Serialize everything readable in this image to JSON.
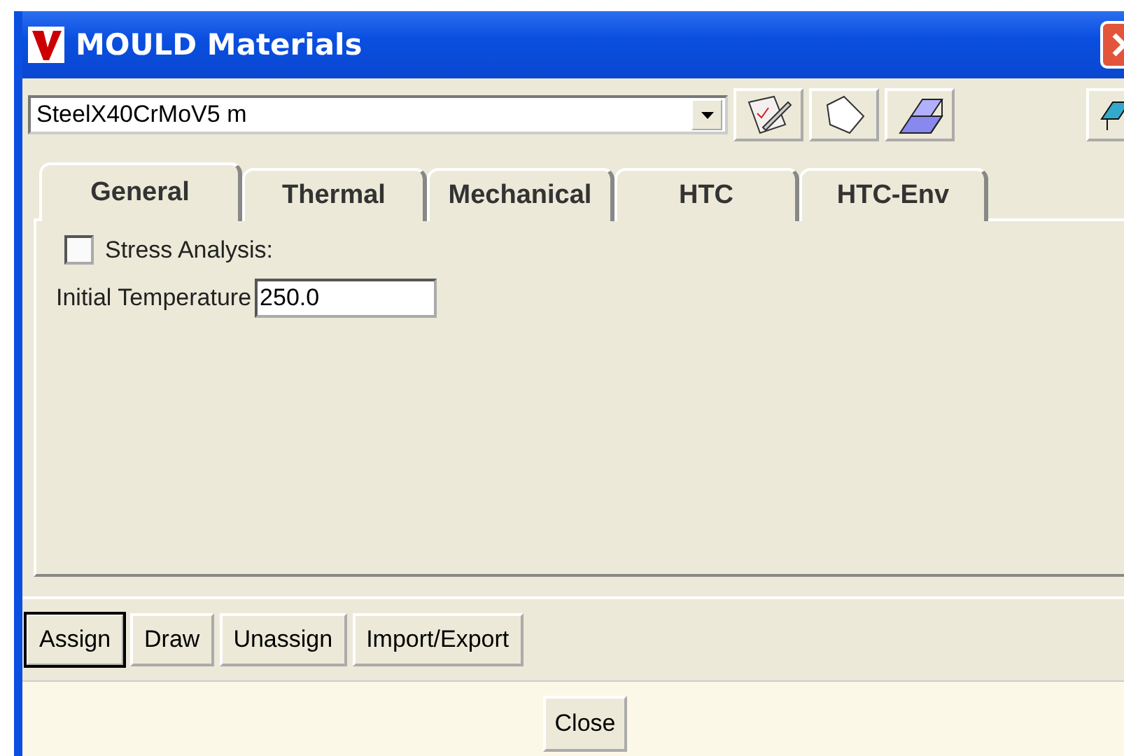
{
  "window": {
    "title": "MOULD Materials"
  },
  "material_select": {
    "value": "SteelX40CrMoV5 m"
  },
  "tabs": [
    {
      "label": "General",
      "selected": true
    },
    {
      "label": "Thermal",
      "selected": false
    },
    {
      "label": "Mechanical",
      "selected": false
    },
    {
      "label": "HTC",
      "selected": false
    },
    {
      "label": "HTC-Env",
      "selected": false
    }
  ],
  "stress_analysis": {
    "label": "Stress Analysis:",
    "checked": false
  },
  "initial_temperature": {
    "label": "Initial Temperature",
    "value": "250.0"
  },
  "action_buttons": [
    {
      "label": "Assign",
      "default": true
    },
    {
      "label": "Draw",
      "default": false
    },
    {
      "label": "Unassign",
      "default": false
    },
    {
      "label": "Import/Export",
      "default": false
    }
  ],
  "close_button": {
    "label": "Close"
  }
}
